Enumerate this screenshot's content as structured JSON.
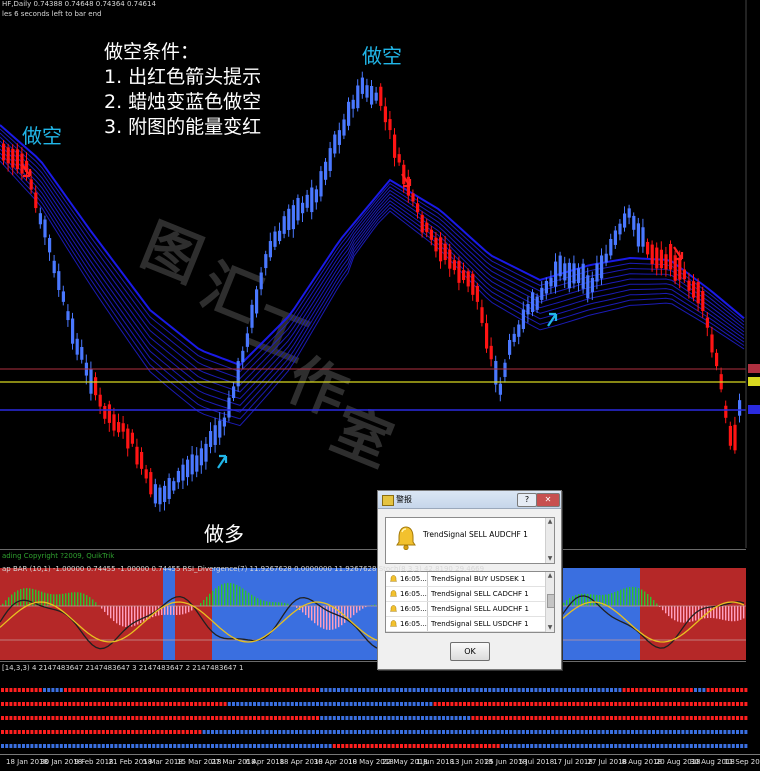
{
  "top_header": {
    "line1": "HF,Daily  0.74388 0.74648 0.74364 0.74614",
    "line2": "les 6 seconds left to bar end"
  },
  "annotations": {
    "short_left": "做空",
    "short_top": "做空",
    "long_bottom": "做多",
    "conditions": [
      "做空条件：",
      "1. 出红色箭头提示",
      "2. 蜡烛变蓝色做空",
      "3. 附图的能量变红"
    ]
  },
  "watermark": "图汇工作室",
  "indicator1": {
    "header": "ap BAR (10,1) -1.00000 0.74455 -1.00000 0.74455  RSI_Divergence(7) 11.9267628 0.0000000 11.9267628  Stoch(8,3,3) 42.8190 29.4669",
    "header_left": "ading  Copyright ?2009, QuikTrik"
  },
  "indicator2": {
    "header": "[14,3,3) 4 2147483647 2147483647 3 2147483647 2 2147483647 1"
  },
  "time_axis": {
    "labels": [
      "18 Jan 2018",
      "30 Jan 2018",
      "9 Feb 2018",
      "21 Feb 2018",
      "5 Mar 2018",
      "15 Mar 2018",
      "27 Mar 2018",
      "6 Apr 2018",
      "18 Apr 2018",
      "30 Apr 2018",
      "10 May 2018",
      "22 May 2018",
      "1 Jun 2018",
      "13 Jun 2018",
      "25 Jun 2018",
      "5 Jul 2018",
      "17 Jul 2018",
      "27 Jul 2018",
      "8 Aug 2018",
      "20 Aug 2018",
      "30 Aug 2018",
      "11 Sep 20"
    ]
  },
  "colors": {
    "bear_candle": "#ff1414",
    "bull_candle": "#4a78ff",
    "ribbon": "#1e1ec8",
    "ribbon_upper": "#1a1ae6",
    "level_yellow": "#d8d820",
    "level_blue": "#2a2ae0",
    "level_red": "#b03040",
    "energy_red": "#b52828",
    "energy_blue": "#3a6fe0",
    "annotation_cyan": "#21b6e8",
    "annotation_text": "#ffffff",
    "watermark": "#555555"
  },
  "dialog": {
    "title": "警报",
    "help_label": "?",
    "close_label": "✕",
    "message": "TrendSignal SELL  AUDCHF  1",
    "alerts": [
      {
        "time": "16:05...",
        "message": "TrendSignal BUY  USDSEK  1"
      },
      {
        "time": "16:05...",
        "message": "TrendSignal SELL  CADCHF  1"
      },
      {
        "time": "16:05...",
        "message": "TrendSignal SELL  AUDCHF  1"
      },
      {
        "time": "16:05...",
        "message": "TrendSignal SELL  USDCHF  1"
      }
    ],
    "ok_label": "OK",
    "icon": "bell-icon"
  },
  "chart_data": {
    "type": "candlestick",
    "symbol_timeframe": "HF,Daily",
    "ohlc_values": [
      "0.74388",
      "0.74648",
      "0.74364",
      "0.74614"
    ],
    "signals": [
      {
        "date": "18 Jan 2018",
        "signal": "sell",
        "label": "做空"
      },
      {
        "date": "21 Mar 2018",
        "signal": "buy"
      },
      {
        "date": "17 May 2018",
        "signal": "sell",
        "label": "做空"
      },
      {
        "date": "3 Jul 2018",
        "signal": "buy"
      },
      {
        "date": "13 Aug 2018",
        "signal": "sell"
      }
    ]
  }
}
